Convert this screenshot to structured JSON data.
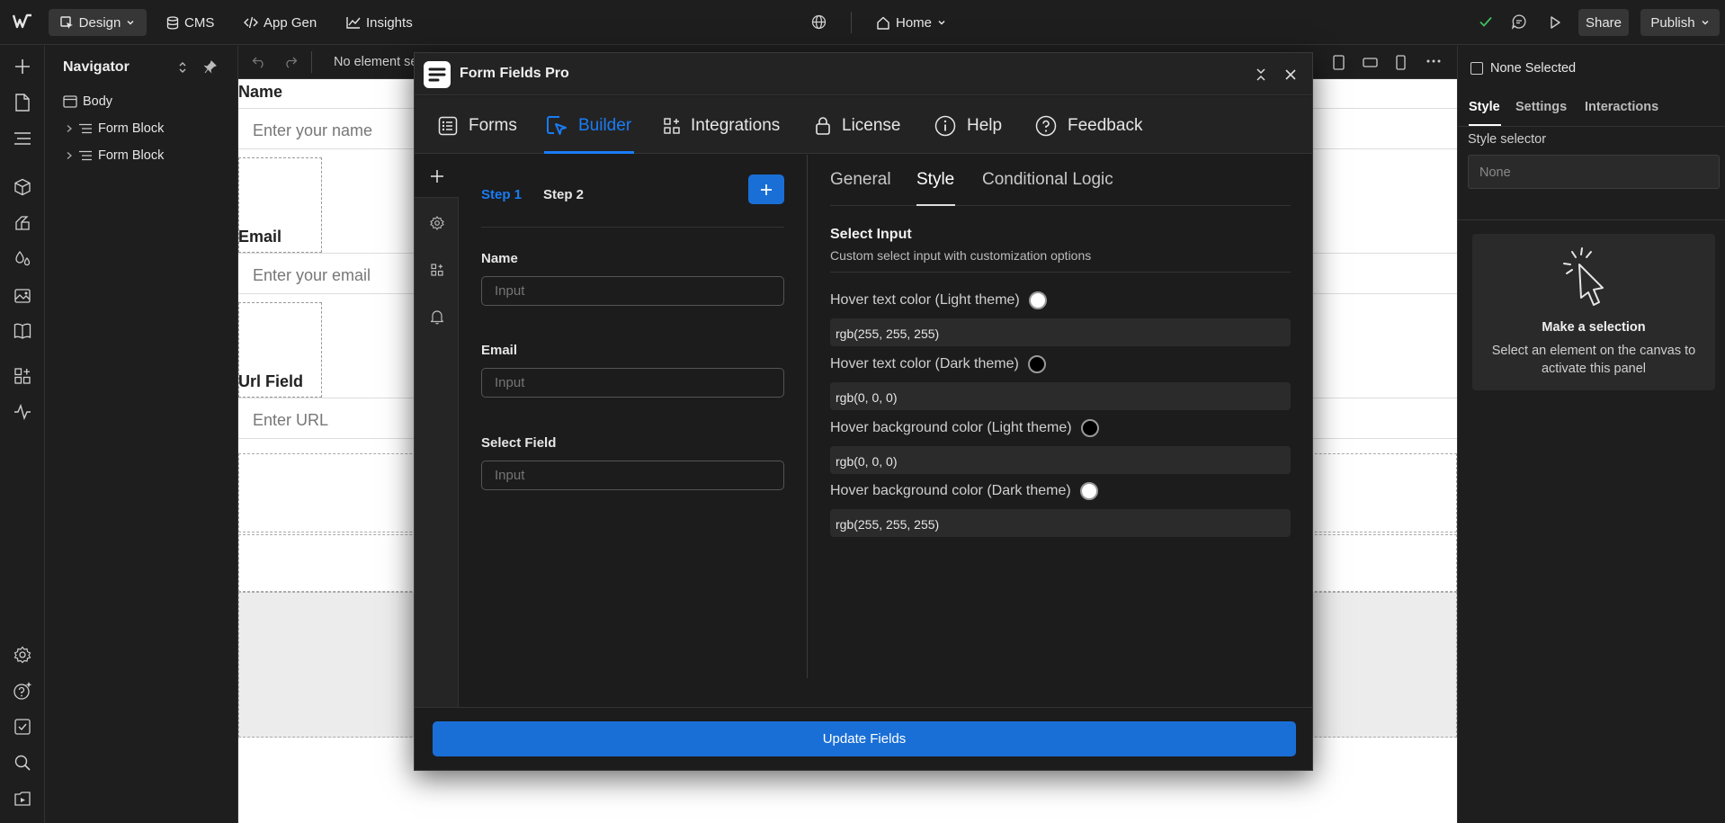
{
  "topbar": {
    "design_label": "Design",
    "cms_label": "CMS",
    "appgen_label": "App Gen",
    "insights_label": "Insights",
    "page_label": "Home",
    "share_label": "Share",
    "publish_label": "Publish"
  },
  "navigator": {
    "title": "Navigator",
    "items": [
      {
        "label": "Body"
      },
      {
        "label": "Form Block"
      },
      {
        "label": "Form Block"
      }
    ]
  },
  "canvas_bar": {
    "status_text": "No element se"
  },
  "canvas": {
    "name_label": "Name",
    "name_placeholder": "Enter your name",
    "email_label": "Email",
    "email_placeholder": "Enter your email",
    "url_label": "Url Field",
    "url_placeholder": "Enter URL"
  },
  "modal": {
    "title": "Form Fields Pro",
    "tabs": [
      {
        "label": "Forms"
      },
      {
        "label": "Builder"
      },
      {
        "label": "Integrations"
      },
      {
        "label": "License"
      },
      {
        "label": "Help"
      },
      {
        "label": "Feedback"
      }
    ],
    "active_tab": "Builder",
    "steps": [
      {
        "label": "Step 1"
      },
      {
        "label": "Step 2"
      }
    ],
    "fields": [
      {
        "label": "Name",
        "placeholder": "Input"
      },
      {
        "label": "Email",
        "placeholder": "Input"
      },
      {
        "label": "Select Field",
        "placeholder": "Input"
      }
    ],
    "settings_tabs": [
      {
        "label": "General"
      },
      {
        "label": "Style"
      },
      {
        "label": "Conditional Logic"
      }
    ],
    "section_title": "Select Input",
    "section_desc": "Custom select input with customization options",
    "options": [
      {
        "label": "Hover text color (Light theme)",
        "value": "rgb(255, 255, 255)",
        "swatch": "#ffffff"
      },
      {
        "label": "Hover text color (Dark theme)",
        "value": "rgb(0, 0, 0)",
        "swatch": "#000000"
      },
      {
        "label": "Hover background color (Light theme)",
        "value": "rgb(0, 0, 0)",
        "swatch": "#000000"
      },
      {
        "label": "Hover background color (Dark theme)",
        "value": "rgb(255, 255, 255)",
        "swatch": "#ffffff"
      }
    ],
    "update_label": "Update Fields"
  },
  "right_panel": {
    "none_selected": "None Selected",
    "tabs": [
      {
        "label": "Style"
      },
      {
        "label": "Settings"
      },
      {
        "label": "Interactions"
      }
    ],
    "style_selector_label": "Style selector",
    "style_selector_value": "None",
    "empty_title": "Make a selection",
    "empty_desc": "Select an element on the canvas to activate this panel"
  },
  "colors": {
    "accent": "#146ef5",
    "background": "#1e1e1e",
    "modal_bg": "#1c1c1c",
    "success": "#3fbf5f"
  }
}
